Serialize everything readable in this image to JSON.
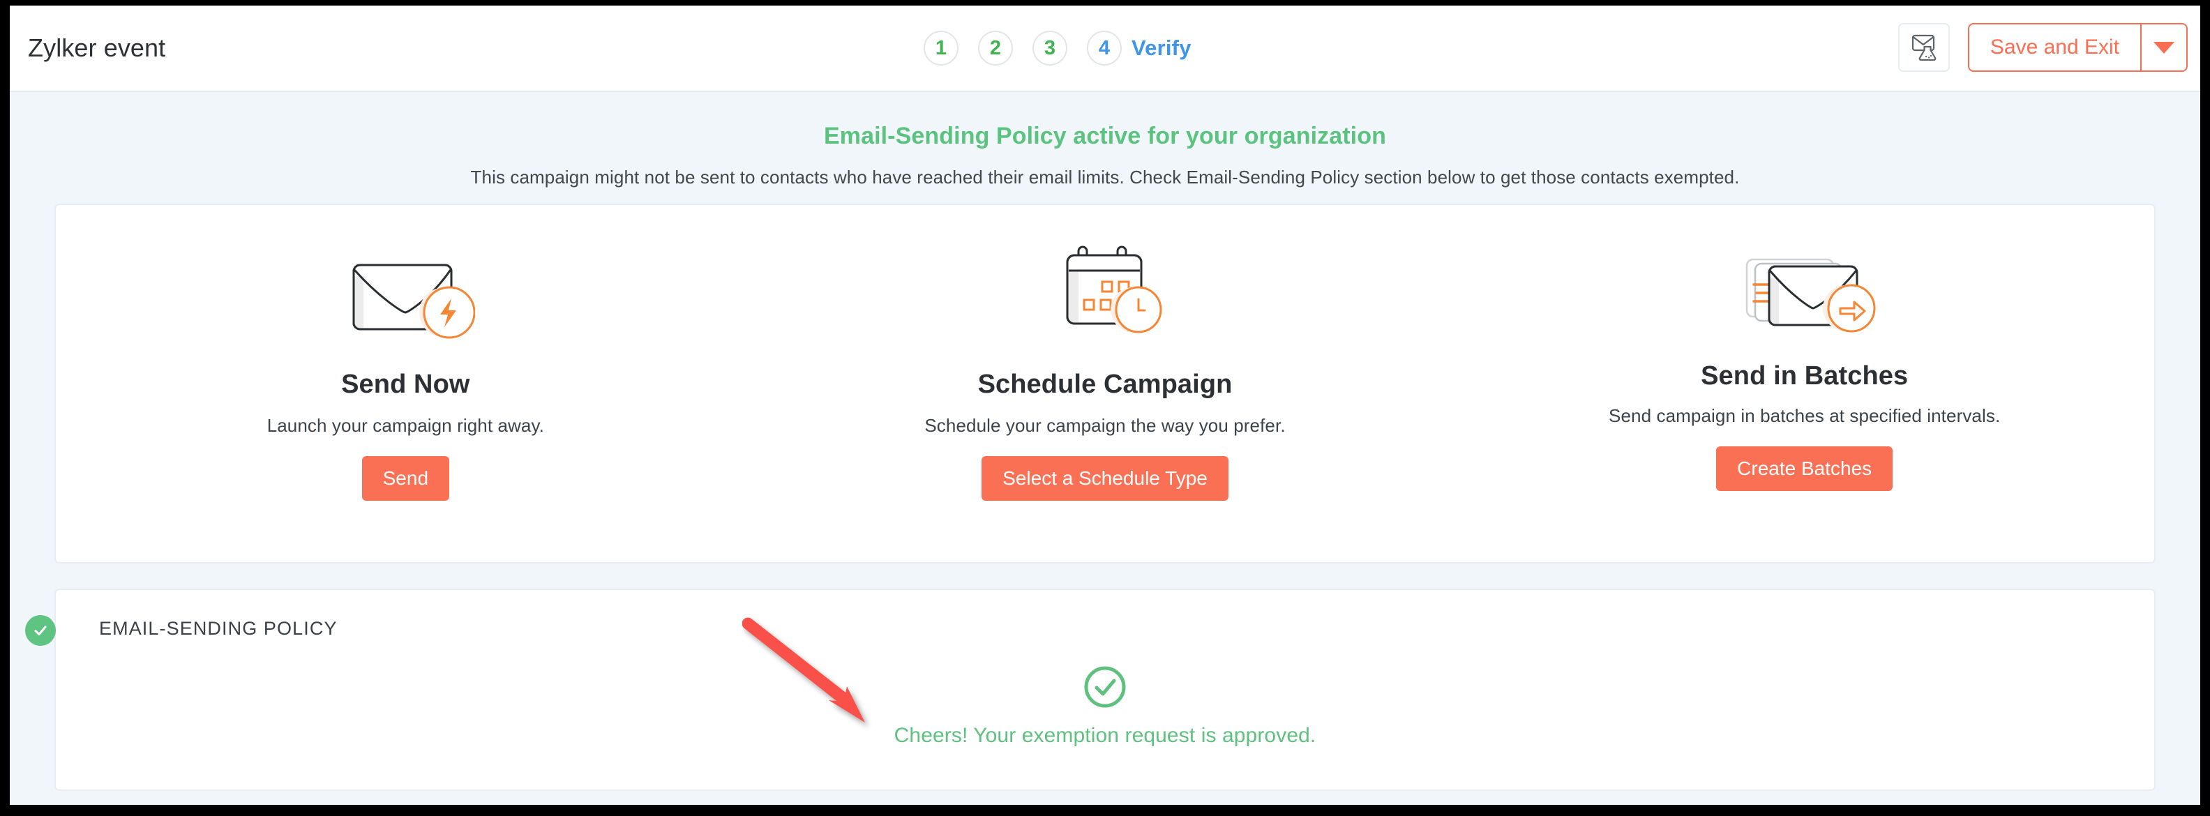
{
  "header": {
    "title": "Zylker event",
    "steps": [
      {
        "number": "1",
        "state": "done"
      },
      {
        "number": "2",
        "state": "done"
      },
      {
        "number": "3",
        "state": "done"
      },
      {
        "number": "4",
        "state": "active"
      }
    ],
    "active_step_label": "Verify",
    "test_email_icon": "envelope-flask-icon",
    "save_exit_label": "Save and Exit",
    "caret_icon": "chevron-down-icon"
  },
  "banner": {
    "title": "Email-Sending Policy active for your organization",
    "description": "This campaign might not be sent to contacts who have reached their email limits. Check Email-Sending Policy section below to get those contacts exempted."
  },
  "options": [
    {
      "icon": "envelope-bolt-icon",
      "title": "Send Now",
      "description": "Launch your campaign right away.",
      "button_label": "Send"
    },
    {
      "icon": "calendar-clock-icon",
      "title": "Schedule Campaign",
      "description": "Schedule your campaign the way you prefer.",
      "button_label": "Select a Schedule Type"
    },
    {
      "icon": "envelopes-arrow-icon",
      "title": "Send in Batches",
      "description": "Send campaign in batches at specified intervals.",
      "button_label": "Create Batches"
    }
  ],
  "policy_section": {
    "status_icon": "check-badge-icon",
    "title": "EMAIL-SENDING POLICY",
    "approved_icon": "check-circle-icon",
    "approved_text": "Cheers! Your exemption request is approved."
  },
  "colors": {
    "accent_orange": "#fa7055",
    "success_green": "#5fc07f",
    "step_done_green": "#3eb34f",
    "step_active_blue": "#3f96e8",
    "page_background": "#f1f6fa",
    "annotation_red": "#f9514a"
  }
}
